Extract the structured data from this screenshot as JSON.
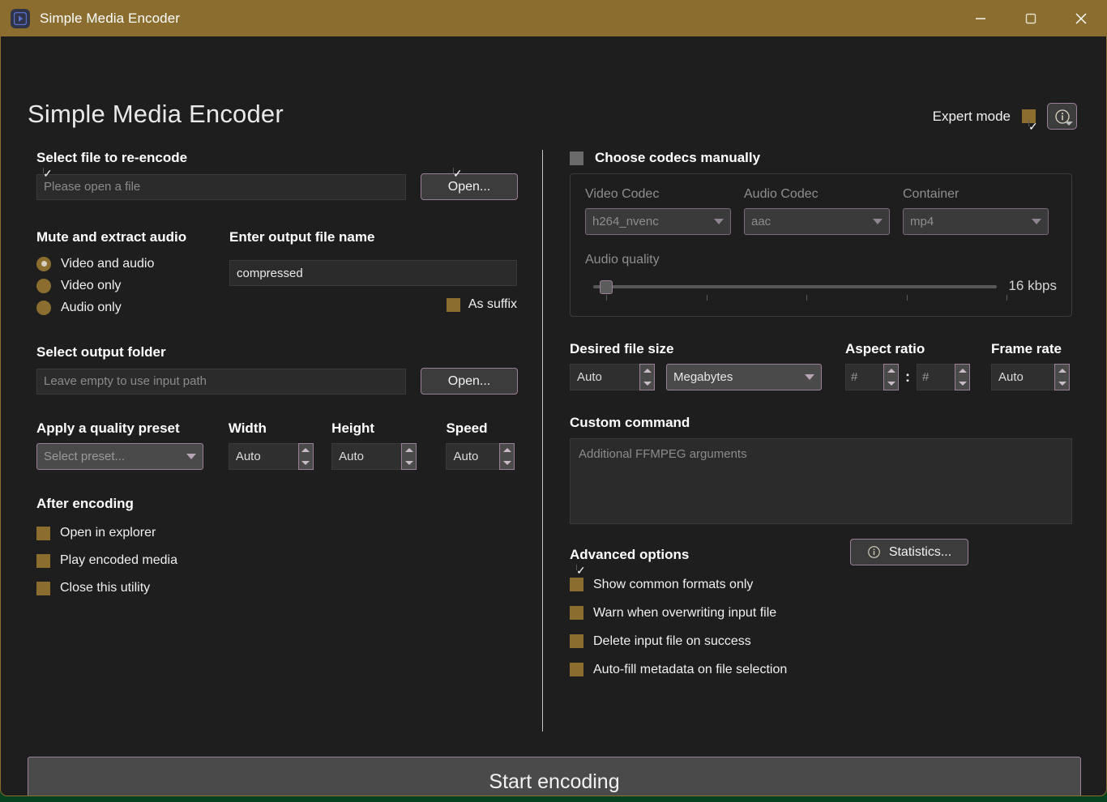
{
  "window": {
    "title": "Simple Media Encoder",
    "app_icon": "play-icon",
    "controls": {
      "minimize": "minimize-icon",
      "maximize": "maximize-icon",
      "close": "close-icon"
    }
  },
  "header": {
    "page_title": "Simple Media Encoder",
    "expert_mode_label": "Expert mode",
    "expert_mode_checked": "✓",
    "info_icon": "info-icon"
  },
  "left": {
    "select_file": {
      "label": "Select file to re-encode",
      "input_placeholder": "Please open a file",
      "open_button": "Open..."
    },
    "mute_extract": {
      "label": "Mute and extract audio",
      "options": [
        {
          "label": "Video and audio",
          "selected": true
        },
        {
          "label": "Video only",
          "selected": false
        },
        {
          "label": "Audio only",
          "selected": false
        }
      ]
    },
    "output_name": {
      "label": "Enter output file name",
      "value": "compressed",
      "as_suffix_label": "As suffix",
      "as_suffix_checked": "✓"
    },
    "output_folder": {
      "label": "Select output folder",
      "input_placeholder": "Leave empty to use input path",
      "open_button": "Open..."
    },
    "quality_preset": {
      "label": "Apply a quality preset",
      "value": "Select preset..."
    },
    "width": {
      "label": "Width",
      "value": "Auto"
    },
    "height": {
      "label": "Height",
      "value": "Auto"
    },
    "speed": {
      "label": "Speed",
      "value": "Auto"
    },
    "after_encoding": {
      "label": "After encoding",
      "options": [
        {
          "label": "Open in explorer",
          "checked": false
        },
        {
          "label": "Play encoded media",
          "checked": true
        },
        {
          "label": "Close this utility",
          "checked": false
        }
      ]
    }
  },
  "right": {
    "choose_codecs": {
      "label": "Choose codecs manually",
      "checked": false
    },
    "video_codec": {
      "label": "Video Codec",
      "value": "h264_nvenc"
    },
    "audio_codec": {
      "label": "Audio Codec",
      "value": "aac"
    },
    "container": {
      "label": "Container",
      "value": "mp4"
    },
    "audio_quality": {
      "label": "Audio quality",
      "value": "16 kbps",
      "position_percent": 0
    },
    "desired_file_size": {
      "label": "Desired file size",
      "value": "Auto",
      "unit": "Megabytes"
    },
    "aspect_ratio": {
      "label": "Aspect ratio",
      "first": "#",
      "separator": ":",
      "second": "#"
    },
    "frame_rate": {
      "label": "Frame rate",
      "value": "Auto"
    },
    "custom_command": {
      "label": "Custom command",
      "placeholder": "Additional FFMPEG arguments"
    },
    "advanced_options": {
      "label": "Advanced options",
      "statistics_button": "Statistics...",
      "statistics_icon": "info-icon",
      "options": [
        {
          "label": "Show common formats only",
          "checked": true
        },
        {
          "label": "Warn when overwriting input file",
          "checked": false
        },
        {
          "label": "Delete input file on success",
          "checked": false
        },
        {
          "label": "Auto-fill metadata on file selection",
          "checked": false
        }
      ]
    }
  },
  "footer": {
    "start_button": "Start encoding"
  },
  "colors": {
    "accent_gold": "#8a6d2f",
    "border_mauve": "#9b7f99",
    "window_bg": "#1e1e1e",
    "desktop": "#06421f"
  }
}
